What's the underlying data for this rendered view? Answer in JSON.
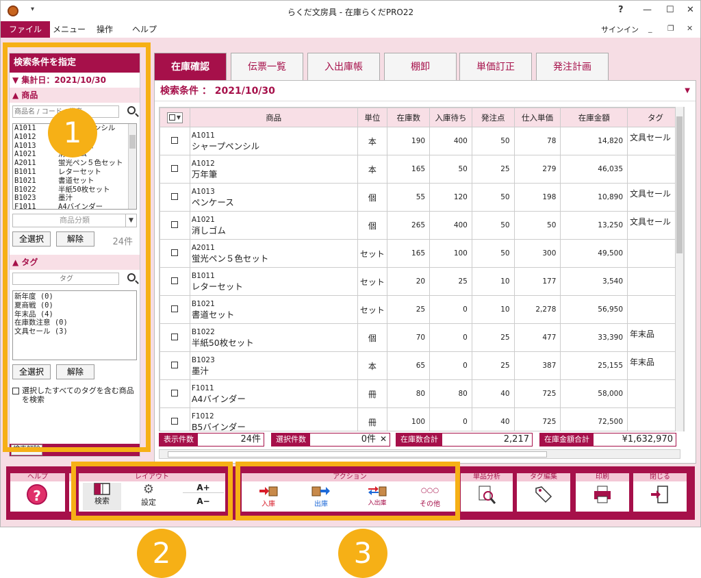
{
  "window": {
    "title": "らくだ文房具 - 在庫らくだPRO22",
    "help_glyph": "?",
    "signin": "サインイン"
  },
  "menu": [
    "ファイル",
    "メニュー",
    "操作",
    "ヘルプ"
  ],
  "left_panel": {
    "header": "検索条件を指定",
    "date_label": "集計日：2021/10/30",
    "product_section": "商品",
    "product_search_placeholder": "商品名 / コード / 備考",
    "product_list": [
      {
        "code": "A1011",
        "name": "シャープペンシル"
      },
      {
        "code": "A1012",
        "name": "万年筆"
      },
      {
        "code": "A1013",
        "name": "ペンケース"
      },
      {
        "code": "A1021",
        "name": "消しゴム"
      },
      {
        "code": "A2011",
        "name": "蛍光ペン５色セット"
      },
      {
        "code": "B1011",
        "name": "レターセット"
      },
      {
        "code": "B1021",
        "name": "書道セット"
      },
      {
        "code": "B1022",
        "name": "半紙50枚セット"
      },
      {
        "code": "B1023",
        "name": "墨汁"
      },
      {
        "code": "F1011",
        "name": "A4バインダー"
      }
    ],
    "category_placeholder": "商品分類",
    "select_all": "全選択",
    "clear": "解除",
    "product_count": "24件",
    "tag_section": "タグ",
    "tag_placeholder": "タグ",
    "tags": [
      "新年度 (0)",
      "夏商戦 (0)",
      "年末品 (4)",
      "在庫数注意 (0)",
      "文具セール (3)"
    ],
    "tag_select_all": "全選択",
    "tag_clear": "解除",
    "include_all_tags": "選択したすべてのタグを含む商品を検索",
    "reset_search": "検索解除"
  },
  "tabs": [
    "在庫確認",
    "伝票一覧",
    "入出庫帳",
    "棚卸",
    "単価訂正",
    "発注計画"
  ],
  "search_condition": "検索条件 ： 2021/10/30",
  "table": {
    "headers": [
      "商品",
      "単位",
      "在庫数",
      "入庫待ち",
      "発注点",
      "仕入単価",
      "在庫金額",
      "タグ"
    ],
    "rows": [
      {
        "code": "A1011",
        "name": "シャープペンシル",
        "unit": "本",
        "stock": "190",
        "incoming": "400",
        "reorder": "50",
        "price": "78",
        "amount": "14,820",
        "tag": "文具セール"
      },
      {
        "code": "A1012",
        "name": "万年筆",
        "unit": "本",
        "stock": "165",
        "incoming": "50",
        "reorder": "25",
        "price": "279",
        "amount": "46,035",
        "tag": ""
      },
      {
        "code": "A1013",
        "name": "ペンケース",
        "unit": "個",
        "stock": "55",
        "incoming": "120",
        "reorder": "50",
        "price": "198",
        "amount": "10,890",
        "tag": "文具セール"
      },
      {
        "code": "A1021",
        "name": "消しゴム",
        "unit": "個",
        "stock": "265",
        "incoming": "400",
        "reorder": "50",
        "price": "50",
        "amount": "13,250",
        "tag": "文具セール"
      },
      {
        "code": "A2011",
        "name": "蛍光ペン５色セット",
        "unit": "セット",
        "stock": "165",
        "incoming": "100",
        "reorder": "50",
        "price": "300",
        "amount": "49,500",
        "tag": ""
      },
      {
        "code": "B1011",
        "name": "レターセット",
        "unit": "セット",
        "stock": "20",
        "incoming": "25",
        "reorder": "10",
        "price": "177",
        "amount": "3,540",
        "tag": ""
      },
      {
        "code": "B1021",
        "name": "書道セット",
        "unit": "セット",
        "stock": "25",
        "incoming": "0",
        "reorder": "10",
        "price": "2,278",
        "amount": "56,950",
        "tag": ""
      },
      {
        "code": "B1022",
        "name": "半紙50枚セット",
        "unit": "個",
        "stock": "70",
        "incoming": "0",
        "reorder": "25",
        "price": "477",
        "amount": "33,390",
        "tag": "年末品"
      },
      {
        "code": "B1023",
        "name": "墨汁",
        "unit": "本",
        "stock": "65",
        "incoming": "0",
        "reorder": "25",
        "price": "387",
        "amount": "25,155",
        "tag": "年末品"
      },
      {
        "code": "F1011",
        "name": "A4バインダー",
        "unit": "冊",
        "stock": "80",
        "incoming": "80",
        "reorder": "40",
        "price": "725",
        "amount": "58,000",
        "tag": ""
      },
      {
        "code": "F1012",
        "name": "B5バインダー",
        "unit": "冊",
        "stock": "100",
        "incoming": "0",
        "reorder": "40",
        "price": "725",
        "amount": "72,500",
        "tag": ""
      }
    ]
  },
  "stats": {
    "display_label": "表示件数",
    "display_value": "24件",
    "selected_label": "選択件数",
    "selected_value": "0件",
    "stock_total_label": "在庫数合計",
    "stock_total_value": "2,217",
    "amount_total_label": "在庫金額合計",
    "amount_total_value": "¥1,632,970"
  },
  "toolbar": {
    "help": "ヘルプ",
    "layout_group": "レイアウト",
    "search": "検索",
    "settings": "設定",
    "font_up": "A+",
    "font_down": "A−",
    "action_group": "アクション",
    "stock_in": "入庫",
    "stock_out": "出庫",
    "in_out": "入出庫",
    "other_dots": "○○○",
    "other": "その他",
    "item_analysis": "単品分析",
    "tag_edit": "タグ編集",
    "print": "印刷",
    "close": "閉じる"
  },
  "callouts": [
    "1",
    "2",
    "3"
  ],
  "colors": {
    "brand": "#a6104a",
    "highlight": "#f6b016",
    "pink_bg": "#f6dde4"
  }
}
